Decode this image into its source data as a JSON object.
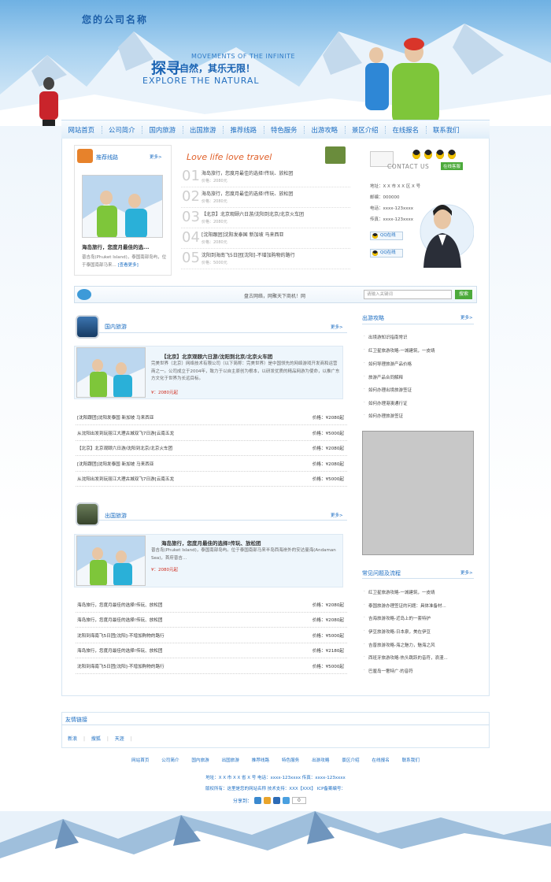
{
  "site": {
    "company_name": "您的公司名称",
    "slogan_big": "探寻",
    "slogan_mid": "自然，其乐无限！",
    "slogan_en_small": "MOVEMENTS OF THE INFINITE",
    "slogan_en_big": "EXPLORE THE NATURAL"
  },
  "nav": [
    "网站首页",
    "公司简介",
    "国内旅游",
    "出国旅游",
    "推荐线路",
    "特色服务",
    "出游攻略",
    "景区介绍",
    "在线报名",
    "联系我们"
  ],
  "recommend": {
    "title": "推荐线路",
    "more": "更多>",
    "caption": "海岛旅行，您度月最佳的选...",
    "desc": "普吉岛(Phuket Island)，泰国南部岛屿，位于泰国南部马来...",
    "detail_link": "[查看更多]"
  },
  "travel_list": {
    "title": "Love life love travel",
    "items": [
      {
        "num": "01",
        "title": "海岛旅行，您度月最佳的选择!传玩、放松团",
        "price": "价格：2080元"
      },
      {
        "num": "02",
        "title": "海岛旅行，您度月最佳的选择!传玩、放松团",
        "price": "价格：2080元"
      },
      {
        "num": "03",
        "title": "【北京】北京观颐六日游/沈阳到北京/北京火车团",
        "price": "价格：2080元"
      },
      {
        "num": "04",
        "title": "[沈阳跟团]沈阳发泰国 新加坡 马来西亚",
        "price": "价格：2080元"
      },
      {
        "num": "05",
        "title": "沈阳到海南飞5日团[沈阳]-不增加购物的路行",
        "price": "价格：5000元"
      }
    ]
  },
  "contact": {
    "label": "CONTACT US",
    "online": "在线客服",
    "address": "地址：X X 市 X X 区 X 号",
    "zip": "邮编：000000",
    "phone": "电话：xxxx-123xxxx",
    "fax": "传真：xxxx-123xxxx",
    "qq1": "QQ在线",
    "qq2": "QQ在线"
  },
  "search": {
    "text": "盘古网络，网聚天下商机！网",
    "placeholder": "请输入关键词",
    "button": "搜索"
  },
  "domestic": {
    "title": "国内旅游",
    "more": "更多>",
    "feature_title": "【北京】北京观颐六日游/沈阳到北京/北京火车团",
    "feature_desc": "完美世界（北京）网络技术有限公司（以下简称：完美世界）是中国领先的网络游戏开发商和运营商之一。公司成立于2004年，致力于以自主原创为根本，以研发优质的精品网游为使命，以推广东方文化于世界为长远目标。",
    "feature_price": "¥：2080元起",
    "rows": [
      {
        "title": "[沈阳跟团]沈阳发泰国 新加坡 马来西亚",
        "price": "价格：¥2080起"
      },
      {
        "title": "从沈阳出发到玩丽江大理古城双飞7日游[云南五龙",
        "price": "价格：¥5000起"
      },
      {
        "title": "【北京】北京观颐六日游/沈阳到北京/北京火车团",
        "price": "价格：¥2080起"
      },
      {
        "title": "[沈阳跟团]沈阳发泰国 新加坡 马来西亚",
        "price": "价格：¥2080起"
      },
      {
        "title": "从沈阳出发到玩丽江大理古城双飞7日游[云南五龙",
        "price": "价格：¥5000起"
      }
    ]
  },
  "outbound": {
    "title": "出国旅游",
    "more": "更多>",
    "feature_title": "海岛旅行，您度月最佳的选择!传玩、放松团",
    "feature_desc": "普吉岛(Phuket Island)，泰国南部岛屿。位于泰国南部马来半岛西海岸外的安达曼海(Andaman Sea)，首府普吉...",
    "feature_price": "¥：2080元起",
    "rows": [
      {
        "title": "海岛旅行，您度月最佳的选择!传玩、放松团",
        "price": "价格：¥2080起"
      },
      {
        "title": "海岛旅行，您度月最佳的选择!传玩、放松团",
        "price": "价格：¥2080起"
      },
      {
        "title": "沈阳到海南飞5日团[沈阳]-不增加购物的路行",
        "price": "价格：¥5000起"
      },
      {
        "title": "海岛旅行，您度月最佳的选择!传玩、放松团",
        "price": "价格：¥2180起"
      },
      {
        "title": "沈阳到海南飞5日团[沈阳]-不增加购物的路行",
        "price": "价格：¥5000起"
      }
    ]
  },
  "guides": {
    "title": "出游攻略",
    "more": "更多>",
    "items": [
      "出境游知识指南常识",
      "红卫星旅游攻略-一城建筑，一皮靖",
      "如何导理旅游产品价格",
      "旅游产品合同解释",
      "如何办理出境旅游签证",
      "如何办理港澳通行证",
      "如何办理旅游签证"
    ]
  },
  "faq": {
    "title": "常见问题及流程",
    "more": "更多>",
    "items": [
      "红卫星旅游攻略-一城建筑，一皮靖",
      "泰国旅游办理签证的问题：具体准备材...",
      "吉海旅游攻略-近岛上的一套特护",
      "伊豆旅游攻略-日本泉，美在伊豆",
      "吉普旅游攻略-海之魅力，魅海之风",
      "西班牙旅游攻略-热头跳跃的音符，浪漫...",
      "巴厘岛一奢特广·的音符"
    ]
  },
  "friend_links": {
    "title": "友情链接",
    "items": [
      "新浪",
      "搜狐",
      "天涯"
    ]
  },
  "footer": {
    "nav": [
      "网站首页",
      "公司简介",
      "国内旅游",
      "出国旅游",
      "推荐线路",
      "特色服务",
      "出游攻略",
      "景区介绍",
      "在线报名",
      "联系我们"
    ],
    "line1": "地址：X X 市 X X 省 X 号  电话：xxxx-123xxxx  传真：xxxx-123xxxx",
    "line2": "版权所有：这里是您的网站名称  技术支持：XXX【XXX】  ICP备案编号：",
    "share_label": "分享到：",
    "share_count": "0"
  }
}
